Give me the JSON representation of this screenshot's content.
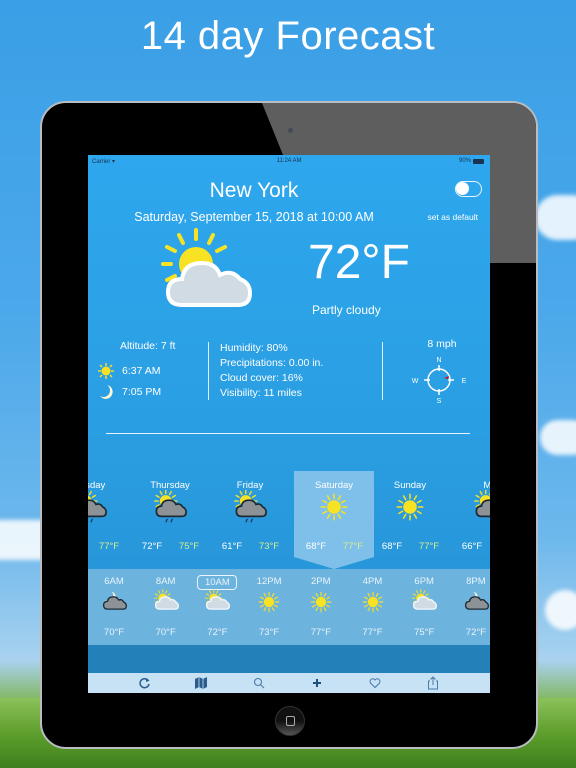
{
  "promo": {
    "headline": "14 day Forecast"
  },
  "status_bar": {
    "carrier": "Carrier",
    "time": "11:24 AM",
    "battery": "90%"
  },
  "header": {
    "city": "New York",
    "datetime": "Saturday, September 15, 2018 at 10:00 AM",
    "set_default_label": "set as default",
    "default_toggle_on": false
  },
  "current": {
    "icon": "partly-cloudy-day-icon",
    "temperature": "72°F",
    "condition": "Partly cloudy"
  },
  "details": {
    "altitude": "Altitude: 7 ft",
    "sunrise": "6:37 AM",
    "sunset": "7:05 PM",
    "humidity": "Humidity: 80%",
    "precipitation": "Precipitations: 0.00 in.",
    "cloud_cover": "Cloud cover: 16%",
    "visibility": "Visibility: 11 miles",
    "wind_speed": "8 mph",
    "compass": {
      "n": "N",
      "s": "S",
      "e": "E",
      "w": "W"
    }
  },
  "daily": [
    {
      "name": "Wednesday",
      "display": "nesday",
      "icon": "rain-partly-cloudy-icon",
      "low": "",
      "high": "77°F",
      "selected": false
    },
    {
      "name": "Thursday",
      "display": "Thursday",
      "icon": "rain-partly-cloudy-icon",
      "low": "72°F",
      "high": "75°F",
      "selected": false
    },
    {
      "name": "Friday",
      "display": "Friday",
      "icon": "rain-partly-cloudy-icon",
      "low": "61°F",
      "high": "73°F",
      "selected": false
    },
    {
      "name": "Saturday",
      "display": "Saturday",
      "icon": "sunny-icon",
      "low": "68°F",
      "high": "77°F",
      "selected": true
    },
    {
      "name": "Sunday",
      "display": "Sunday",
      "icon": "sunny-icon",
      "low": "68°F",
      "high": "77°F",
      "selected": false
    },
    {
      "name": "Monday",
      "display": "Mo",
      "icon": "partly-cloudy-dark-icon",
      "low": "66°F",
      "high": "",
      "selected": false
    }
  ],
  "hourly": [
    {
      "time": "6AM",
      "icon": "night-cloudy-icon",
      "temp": "70°F",
      "selected": false
    },
    {
      "time": "8AM",
      "icon": "partly-cloudy-day-icon",
      "temp": "70°F",
      "selected": false
    },
    {
      "time": "10AM",
      "icon": "partly-cloudy-day-icon",
      "temp": "72°F",
      "selected": true
    },
    {
      "time": "12PM",
      "icon": "sunny-icon",
      "temp": "73°F",
      "selected": false
    },
    {
      "time": "2PM",
      "icon": "sunny-icon",
      "temp": "77°F",
      "selected": false
    },
    {
      "time": "4PM",
      "icon": "sunny-icon",
      "temp": "77°F",
      "selected": false
    },
    {
      "time": "6PM",
      "icon": "partly-cloudy-day-icon",
      "temp": "75°F",
      "selected": false
    },
    {
      "time": "8PM",
      "icon": "night-cloudy-icon",
      "temp": "72°F",
      "selected": false
    }
  ],
  "toolbar": [
    {
      "name": "refresh-icon"
    },
    {
      "name": "map-icon"
    },
    {
      "name": "search-icon"
    },
    {
      "name": "add-icon"
    },
    {
      "name": "favorite-icon"
    },
    {
      "name": "share-icon"
    }
  ],
  "colors": {
    "screen_top": "#2ea7ee",
    "screen_bottom": "#2690d3",
    "high_temp": "#d6ee8c",
    "selected_day": "#7ec0ea",
    "hour_strip": "#6cb3de",
    "toolbar_bg": "#c7e1f5",
    "toolbar_icon": "#2a5c8c",
    "sun": "#f7e223",
    "cloud_light": "#d0dbe4",
    "cloud_dark": "#8c9296"
  }
}
